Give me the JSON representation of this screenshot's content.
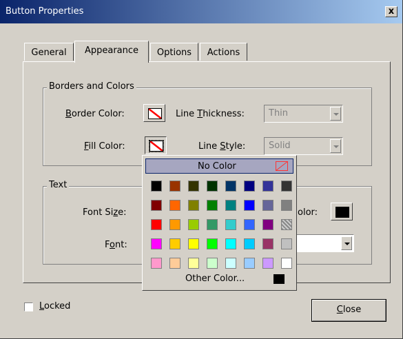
{
  "window": {
    "title": "Button Properties",
    "close_glyph": "x"
  },
  "tabs": [
    {
      "label": "General",
      "active": false
    },
    {
      "label": "Appearance",
      "active": true
    },
    {
      "label": "Options",
      "active": false
    },
    {
      "label": "Actions",
      "active": false
    }
  ],
  "borders_group": {
    "title": "Borders and Colors",
    "border_color_pre": "B",
    "border_color_rest": "order Color:",
    "fill_color_pre": "F",
    "fill_color_rest": "ill Color:",
    "line_thickness_pre": "Line ",
    "line_thickness_mn": "T",
    "line_thickness_rest": "hickness:",
    "line_thickness_value": "Thin",
    "line_style_pre": "Line ",
    "line_style_mn": "S",
    "line_style_rest": "tyle:",
    "line_style_value": "Solid"
  },
  "text_group": {
    "title": "Text",
    "font_size_pre": "Font Si",
    "font_size_mn": "z",
    "font_size_rest": "e:",
    "font_pre": "F",
    "font_mn": "o",
    "font_rest": "nt:",
    "text_color_partial": "olor:",
    "text_color_value": "#000000"
  },
  "color_popup": {
    "no_color_label": "No Color",
    "other_color_label": "Other Color...",
    "other_color_value": "#000000",
    "palette": [
      [
        "#000000",
        "#993300",
        "#333300",
        "#003300",
        "#003366",
        "#000080",
        "#333399",
        "#333333"
      ],
      [
        "#800000",
        "#FF6600",
        "#808000",
        "#008000",
        "#008080",
        "#0000FF",
        "#666699",
        "#808080"
      ],
      [
        "#FF0000",
        "#FF9900",
        "#99CC00",
        "#339966",
        "#33CCCC",
        "#3366FF",
        "#800080",
        "hatch"
      ],
      [
        "#FF00FF",
        "#FFCC00",
        "#FFFF00",
        "#00FF00",
        "#00FFFF",
        "#00CCFF",
        "#993366",
        "#C0C0C0"
      ],
      [
        "#FF99CC",
        "#FFCC99",
        "#FFFF99",
        "#CCFFCC",
        "#CCFFFF",
        "#99CCFF",
        "#CC99FF",
        "#FFFFFF"
      ]
    ]
  },
  "footer": {
    "locked_mn": "L",
    "locked_rest": "ocked",
    "locked_checked": false,
    "close_mn": "C",
    "close_rest": "lose"
  }
}
